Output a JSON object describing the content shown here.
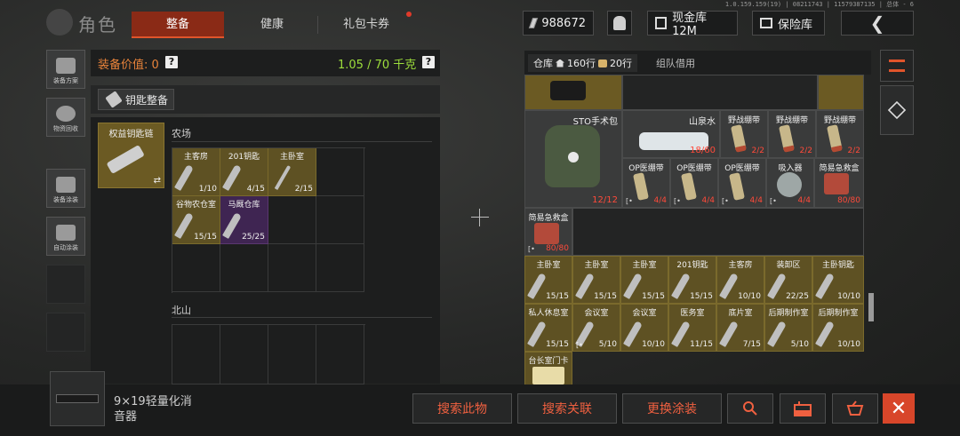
{
  "version": "1.0.159.159(19) | 08211743 | 11579387135 | 总体 - 6",
  "title": "角色",
  "tabs": [
    {
      "label": "整备",
      "active": true
    },
    {
      "label": "健康",
      "active": false
    },
    {
      "label": "礼包卡券",
      "active": false,
      "badge": true
    }
  ],
  "top_right": {
    "currency": "988672",
    "cash_label": "现金库 12M",
    "safe_label": "保险库",
    "back_icon": "back-arrow-icon"
  },
  "sidebar": [
    {
      "label": "装备方案",
      "icon": "loadout-icon"
    },
    {
      "label": "物资回收",
      "icon": "recycle-icon"
    },
    {
      "label": "装备涂装",
      "icon": "paint-helmet-icon"
    },
    {
      "label": "自动涂装",
      "icon": "auto-paint-icon"
    }
  ],
  "left_panel": {
    "equip_value_label": "装备价值: 0",
    "weight": "1.05 / 70 千克",
    "key_section_title": "钥匙整备",
    "keychain_name": "权益钥匙链",
    "swap_symbol": "⇄",
    "zones": [
      {
        "name": "农场",
        "keys": [
          {
            "name": "主客房",
            "count": "1/10",
            "variant": "gold"
          },
          {
            "name": "201钥匙",
            "count": "4/15",
            "variant": "gold"
          },
          {
            "name": "主卧室",
            "count": "2/15",
            "variant": "gold"
          },
          {
            "name": "谷物农仓室",
            "count": "15/15",
            "variant": "gold"
          },
          {
            "name": "马厩仓库",
            "count": "25/25",
            "variant": "purple"
          }
        ]
      },
      {
        "name": "北山",
        "keys": []
      }
    ]
  },
  "stash": {
    "tabs": [
      {
        "label": "仓库",
        "rows": "160行",
        "groups": "20行",
        "active": true
      },
      {
        "label": "组队借用",
        "active": false
      }
    ],
    "consumables": [
      {
        "name": "STO手术包",
        "count": "12/12"
      },
      {
        "name": "山泉水",
        "count": "18/60"
      },
      {
        "name": "野战绷带",
        "count": "2/2"
      },
      {
        "name": "野战绷带",
        "count": "2/2"
      },
      {
        "name": "野战绷带",
        "count": "2/2"
      },
      {
        "name": "OP医绷带",
        "count": "4/4"
      },
      {
        "name": "OP医绷带",
        "count": "4/4"
      },
      {
        "name": "OP医绷带",
        "count": "4/4"
      },
      {
        "name": "吸入器",
        "count": "4/4"
      },
      {
        "name": "简易急救盒",
        "count": "80/80"
      },
      {
        "name": "简易急救盒",
        "count": "80/80"
      }
    ],
    "keys_row1": [
      {
        "name": "主卧室",
        "count": "15/15"
      },
      {
        "name": "主卧室",
        "count": "15/15"
      },
      {
        "name": "主卧室",
        "count": "15/15"
      },
      {
        "name": "201钥匙",
        "count": "15/15"
      },
      {
        "name": "主客房",
        "count": "10/10"
      },
      {
        "name": "装卸区",
        "count": "22/25"
      },
      {
        "name": "主卧钥匙",
        "count": "10/10"
      }
    ],
    "keys_row2": [
      {
        "name": "私人休息室",
        "count": "15/15"
      },
      {
        "name": "会议室",
        "count": "5/10"
      },
      {
        "name": "会议室",
        "count": "10/10"
      },
      {
        "name": "医务室",
        "count": "11/15"
      },
      {
        "name": "底片室",
        "count": "7/15"
      },
      {
        "name": "后期制作室",
        "count": "5/10"
      },
      {
        "name": "后期制作室",
        "count": "10/10"
      }
    ],
    "last_item": {
      "name": "台长室门卡"
    }
  },
  "bottom": {
    "selected_item": "9×19轻量化消音器",
    "actions": [
      "搜索此物",
      "搜索关联",
      "更换涂装"
    ],
    "icons": [
      "search-icon",
      "box-icon",
      "basket-icon",
      "close-icon"
    ]
  },
  "colors": {
    "accent": "#d8462a",
    "tab_active": "#8a2a16",
    "gold_cell": "#5e5123",
    "purple_cell": "#3f2552",
    "weight_green": "#9dde3c",
    "value_orange": "#e8833a",
    "count_red": "#ff4a3a"
  }
}
